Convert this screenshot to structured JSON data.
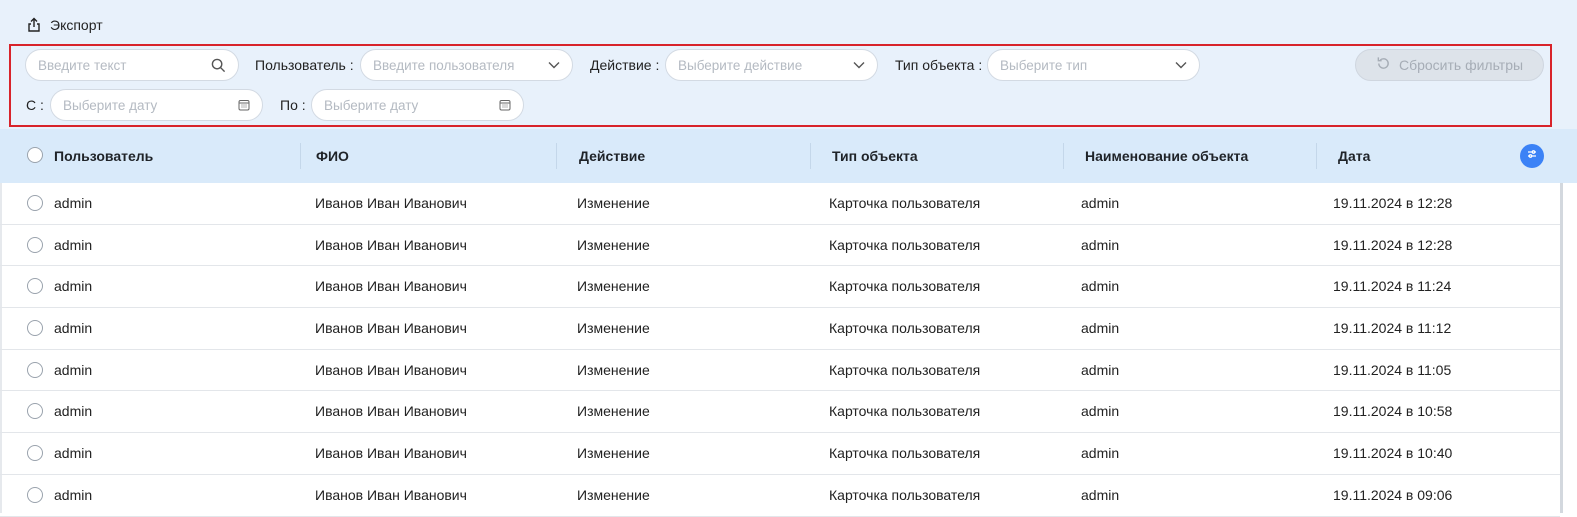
{
  "toolbar": {
    "export_label": "Экспорт",
    "export_icon": "export-icon"
  },
  "filters": {
    "search_placeholder": "Введите текст",
    "user_label": "Пользователь",
    "user_placeholder": "Введите пользователя",
    "action_label": "Действие",
    "action_placeholder": "Выберите действие",
    "object_type_label": "Тип объекта",
    "object_type_placeholder": "Выберите тип",
    "reset_label": "Сбросить фильтры",
    "from_label": "С",
    "from_placeholder": "Выберите дату",
    "to_label": "По",
    "to_placeholder": "Выберите дату",
    "label_separator": ":"
  },
  "table": {
    "headers": [
      "Пользователь",
      "ФИО",
      "Действие",
      "Тип объекта",
      "Наименование объекта",
      "Дата"
    ],
    "rows": [
      {
        "user": "admin",
        "fio": "Иванов Иван Иванович",
        "action": "Изменение",
        "object_type": "Карточка пользователя",
        "object_name": "admin",
        "date": "19.11.2024 в 12:28"
      },
      {
        "user": "admin",
        "fio": "Иванов Иван Иванович",
        "action": "Изменение",
        "object_type": "Карточка пользователя",
        "object_name": "admin",
        "date": "19.11.2024 в 12:28"
      },
      {
        "user": "admin",
        "fio": "Иванов Иван Иванович",
        "action": "Изменение",
        "object_type": "Карточка пользователя",
        "object_name": "admin",
        "date": "19.11.2024 в 11:24"
      },
      {
        "user": "admin",
        "fio": "Иванов Иван Иванович",
        "action": "Изменение",
        "object_type": "Карточка пользователя",
        "object_name": "admin",
        "date": "19.11.2024 в 11:12"
      },
      {
        "user": "admin",
        "fio": "Иванов Иван Иванович",
        "action": "Изменение",
        "object_type": "Карточка пользователя",
        "object_name": "admin",
        "date": "19.11.2024 в 11:05"
      },
      {
        "user": "admin",
        "fio": "Иванов Иван Иванович",
        "action": "Изменение",
        "object_type": "Карточка пользователя",
        "object_name": "admin",
        "date": "19.11.2024 в 10:58"
      },
      {
        "user": "admin",
        "fio": "Иванов Иван Иванович",
        "action": "Изменение",
        "object_type": "Карточка пользователя",
        "object_name": "admin",
        "date": "19.11.2024 в 10:40"
      },
      {
        "user": "admin",
        "fio": "Иванов Иван Иванович",
        "action": "Изменение",
        "object_type": "Карточка пользователя",
        "object_name": "admin",
        "date": "19.11.2024 в 09:06"
      }
    ]
  },
  "colors": {
    "accent": "#3b82f6",
    "header_bg": "#d9eafa",
    "top_bg": "#e8f1fb",
    "highlight_border": "#d8232a"
  }
}
